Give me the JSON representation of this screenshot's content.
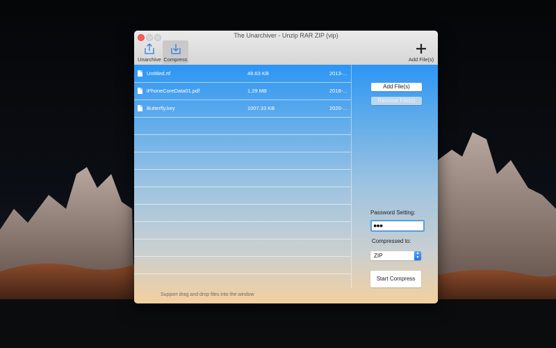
{
  "window": {
    "title": "The Unarchiver - Unzip RAR ZIP (vip)"
  },
  "toolbar": {
    "unarchive_label": "Unarchive",
    "compress_label": "Compress",
    "add_files_label": "Add File(s)"
  },
  "files": [
    {
      "name": "Untitled.rtf",
      "size": "48.63 KB",
      "date": "2013-..."
    },
    {
      "name": "iPhoneCoreData01.pdf",
      "size": "1.29 MB",
      "date": "2018-..."
    },
    {
      "name": "Butterfly.key",
      "size": "1007.33 KB",
      "date": "2020-..."
    }
  ],
  "hint": "Support drag and drop files into the window",
  "side": {
    "add_button": "Add File(s)",
    "remove_button": "Remove File(s)",
    "password_label": "Password Setting:",
    "password_value": "●●●",
    "compressed_label": "Compressed to:",
    "format_value": "ZIP",
    "start_button": "Start Compress"
  },
  "colors": {
    "accent": "#2d95f5",
    "close": "#fc5d57"
  },
  "icons": [
    "unarchive-icon",
    "compress-icon",
    "plus-icon",
    "document-icon",
    "stepper-icon"
  ]
}
